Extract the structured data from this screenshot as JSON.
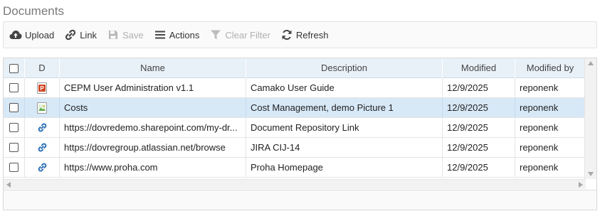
{
  "panel": {
    "title": "Documents"
  },
  "toolbar": {
    "upload": "Upload",
    "link": "Link",
    "save": "Save",
    "actions": "Actions",
    "clear_filter": "Clear Filter",
    "refresh": "Refresh"
  },
  "grid": {
    "columns": {
      "d": "D",
      "name": "Name",
      "description": "Description",
      "modified": "Modified",
      "modified_by": "Modified by"
    },
    "rows": [
      {
        "icon": "powerpoint-file-icon",
        "name": "CEPM User Administration v1.1",
        "description": "Camako User Guide",
        "modified": "12/9/2025",
        "modified_by": "reponenk"
      },
      {
        "icon": "image-file-icon",
        "name": "Costs",
        "description": "Cost Management, demo Picture 1",
        "modified": "12/9/2025",
        "modified_by": "reponenk"
      },
      {
        "icon": "link-icon",
        "name": "https://dovredemo.sharepoint.com/my-dr...",
        "description": "Document Repository Link",
        "modified": "12/9/2025",
        "modified_by": "reponenk"
      },
      {
        "icon": "link-icon",
        "name": "https://dovregroup.atlassian.net/browse",
        "description": "JIRA CIJ-14",
        "modified": "12/9/2025",
        "modified_by": "reponenk"
      },
      {
        "icon": "link-icon",
        "name": "https://www.proha.com",
        "description": "Proha Homepage",
        "modified": "12/9/2025",
        "modified_by": "reponenk"
      }
    ],
    "selected_row": 1
  },
  "colors": {
    "header_bg": "#e8f0f8",
    "selected_row_bg": "#d7e8f7",
    "link_icon": "#2a6fb8",
    "powerpoint_icon": "#d24726",
    "disabled_text": "#b0b0b0"
  }
}
